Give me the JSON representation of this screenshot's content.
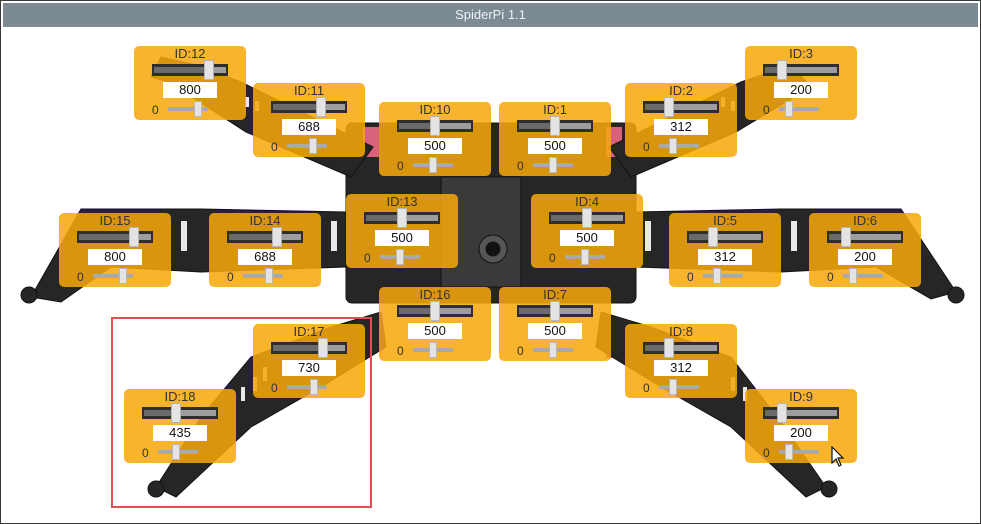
{
  "window": {
    "title": "SpiderPi 1.1"
  },
  "servos": [
    {
      "id": "ID:12",
      "value": "800",
      "zero": "0",
      "level": 0.8
    },
    {
      "id": "ID:11",
      "value": "688",
      "zero": "0",
      "level": 0.69
    },
    {
      "id": "ID:10",
      "value": "500",
      "zero": "0",
      "level": 0.5
    },
    {
      "id": "ID:1",
      "value": "500",
      "zero": "0",
      "level": 0.5
    },
    {
      "id": "ID:2",
      "value": "312",
      "zero": "0",
      "level": 0.31
    },
    {
      "id": "ID:3",
      "value": "200",
      "zero": "0",
      "level": 0.2
    },
    {
      "id": "ID:15",
      "value": "800",
      "zero": "0",
      "level": 0.8
    },
    {
      "id": "ID:14",
      "value": "688",
      "zero": "0",
      "level": 0.69
    },
    {
      "id": "ID:13",
      "value": "500",
      "zero": "0",
      "level": 0.5
    },
    {
      "id": "ID:4",
      "value": "500",
      "zero": "0",
      "level": 0.5
    },
    {
      "id": "ID:5",
      "value": "312",
      "zero": "0",
      "level": 0.31
    },
    {
      "id": "ID:6",
      "value": "200",
      "zero": "0",
      "level": 0.2
    },
    {
      "id": "ID:16",
      "value": "500",
      "zero": "0",
      "level": 0.5
    },
    {
      "id": "ID:7",
      "value": "500",
      "zero": "0",
      "level": 0.5
    },
    {
      "id": "ID:17",
      "value": "730",
      "zero": "0",
      "level": 0.73
    },
    {
      "id": "ID:8",
      "value": "312",
      "zero": "0",
      "level": 0.31
    },
    {
      "id": "ID:18",
      "value": "435",
      "zero": "0",
      "level": 0.44
    },
    {
      "id": "ID:9",
      "value": "200",
      "zero": "0",
      "level": 0.2
    }
  ],
  "colors": {
    "panel": "#f7a80a",
    "titlebar": "#7c8a93",
    "highlight": "#e05050",
    "robot_body": "#262626"
  }
}
